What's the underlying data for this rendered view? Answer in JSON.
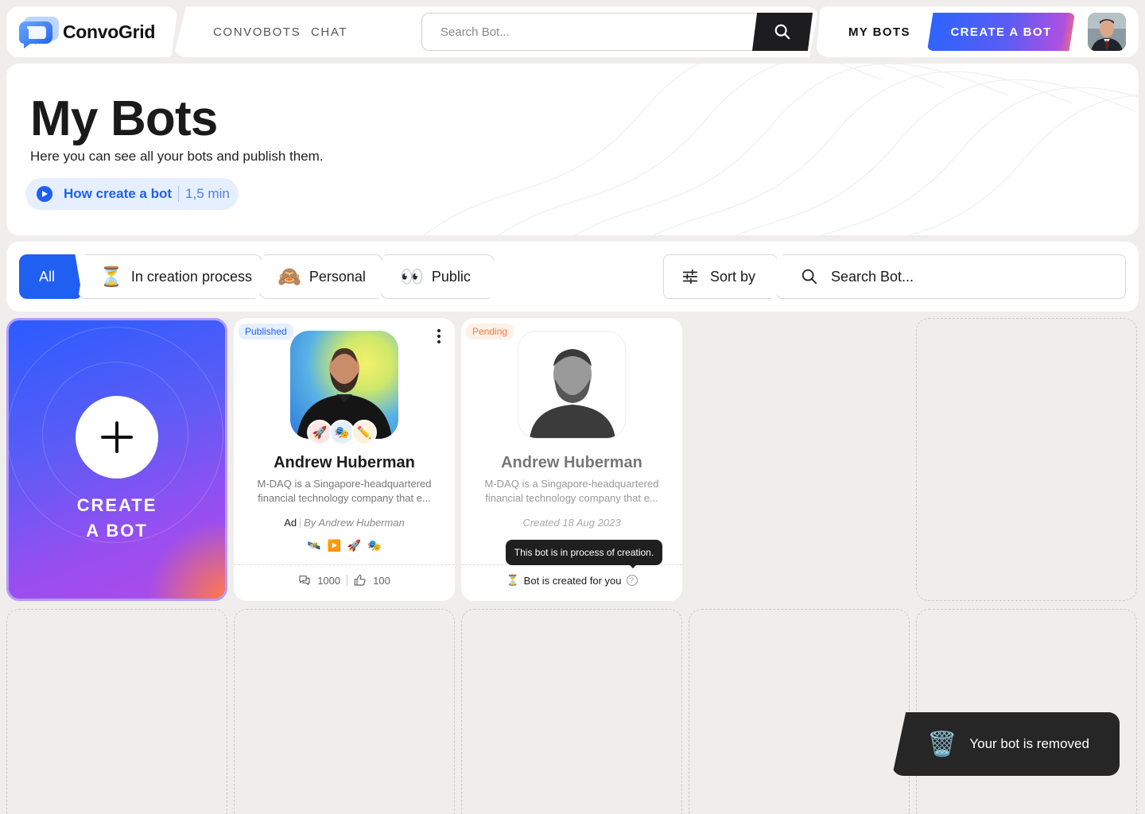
{
  "brand": {
    "name": "ConvoGrid"
  },
  "nav": {
    "links": [
      "CONVOBOTS",
      "CHAT"
    ],
    "search_placeholder": "Search Bot...",
    "my_bots": "MY BOTS",
    "create_bot": "CREATE A BOT"
  },
  "hero": {
    "title": "My Bots",
    "subtitle": "Here you can see all your bots and publish them.",
    "how_label": "How create a bot",
    "how_duration": "1,5 min"
  },
  "filters": {
    "chips": [
      {
        "label": "All",
        "emoji": ""
      },
      {
        "label": "In creation process",
        "emoji": "⏳"
      },
      {
        "label": "Personal",
        "emoji": "🙈"
      },
      {
        "label": "Public",
        "emoji": "👀"
      }
    ],
    "sort_label": "Sort by",
    "search_placeholder": "Search Bot..."
  },
  "create_card": {
    "line1": "CREATE",
    "line2": "A BOT"
  },
  "cards": [
    {
      "status": "Published",
      "name": "Andrew Huberman",
      "description": "M-DAQ is a Singapore-headquartered financial technology company that e...",
      "ad": "Ad",
      "by": "By Andrew Huberman",
      "tags": [
        "🚀",
        "🎭",
        "✏️"
      ],
      "sources": [
        "🛰️",
        "▶️",
        "🚀",
        "🎭"
      ],
      "chats": "1000",
      "likes": "100"
    },
    {
      "status": "Pending",
      "name": "Andrew Huberman",
      "description": "M-DAQ is a Singapore-headquartered financial technology company that e...",
      "created": "Created 18 Aug 2023",
      "tooltip": "This bot is in process of creation.",
      "footer": "Bot is created for you",
      "footer_icon": "⏳",
      "help": "?"
    }
  ],
  "toast": {
    "icon": "🗑️",
    "message": "Your bot is removed"
  },
  "colors": {
    "accent": "#1f5ff2",
    "dark": "#1d1d1f",
    "pending": "#f07a3a"
  }
}
